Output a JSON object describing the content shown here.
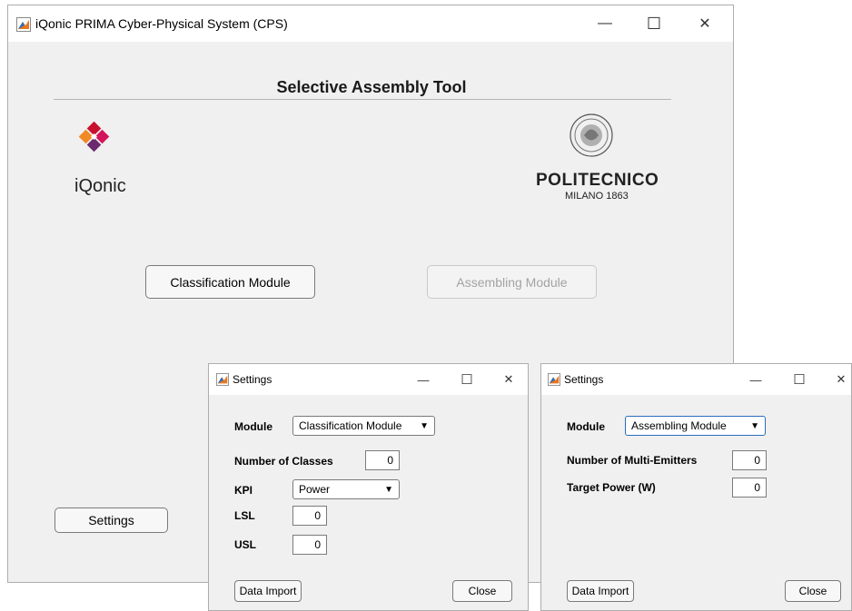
{
  "main_window": {
    "title": "iQonic PRIMA Cyber-Physical System (CPS)",
    "heading": "Selective Assembly Tool",
    "logo_left_text": "iQonic",
    "logo_right_text_1": "POLITECNICO",
    "logo_right_text_2": "MILANO 1863",
    "classification_button": "Classification Module",
    "assembling_button": "Assembling Module",
    "settings_button": "Settings",
    "controls": {
      "minimize": "—",
      "maximize": "☐",
      "close": "✕"
    }
  },
  "settings_classification": {
    "title": "Settings",
    "module_label": "Module",
    "module_value": "Classification Module",
    "num_classes_label": "Number of Classes",
    "num_classes_value": "0",
    "kpi_label": "KPI",
    "kpi_value": "Power",
    "lsl_label": "LSL",
    "lsl_value": "0",
    "usl_label": "USL",
    "usl_value": "0",
    "data_import_button": "Data Import",
    "close_button": "Close",
    "controls": {
      "minimize": "—",
      "maximize": "☐",
      "close": "✕"
    }
  },
  "settings_assembling": {
    "title": "Settings",
    "module_label": "Module",
    "module_value": "Assembling Module",
    "num_emitters_label": "Number of Multi-Emitters",
    "num_emitters_value": "0",
    "target_power_label": "Target Power (W)",
    "target_power_value": "0",
    "data_import_button": "Data Import",
    "close_button": "Close",
    "controls": {
      "minimize": "—",
      "maximize": "☐",
      "close": "✕"
    }
  },
  "icons": {
    "app_icon": "matlab-icon",
    "dropdown_arrow": "▼"
  },
  "colors": {
    "window_bg": "#f0f0f0",
    "iqonic_orange": "#f08a24",
    "iqonic_red": "#c8102e",
    "iqonic_purple": "#6b2a6e",
    "disabled_text": "#a3a3a3"
  }
}
